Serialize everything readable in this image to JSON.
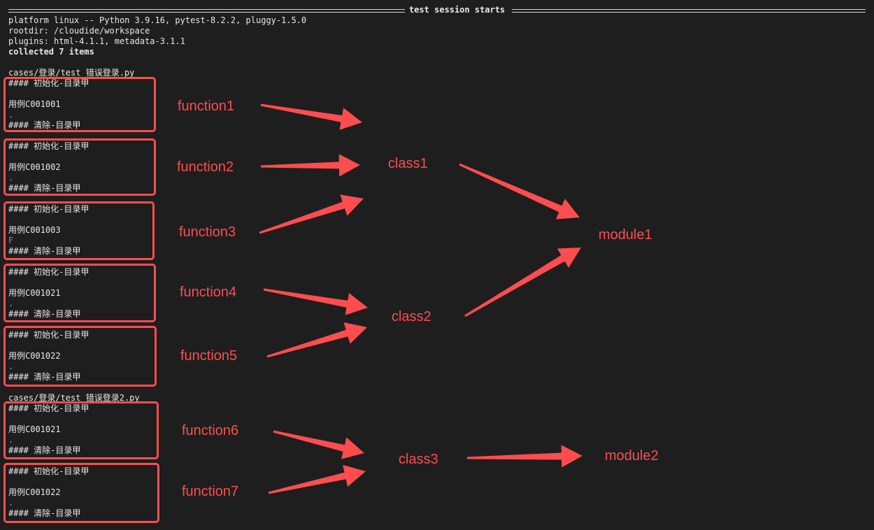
{
  "terminal": {
    "session_header": "test session starts",
    "platform_line": "platform linux -- Python 3.9.16, pytest-8.2.2, pluggy-1.5.0",
    "rootdir_line": "rootdir: /cloudide/workspace",
    "plugins_line": "plugins: html-4.1.1, metadata-3.1.1",
    "collected_line": "collected 7 items",
    "file1_path": "cases/登录/test_错误登录.py",
    "file2_path": "cases/登录/test_错误登录2.py",
    "tests": [
      {
        "setup": "#### 初始化-目录甲",
        "case": "用例C001001",
        "result": ".",
        "teardown": "#### 清除-目录甲"
      },
      {
        "setup": "#### 初始化-目录甲",
        "case": "用例C001002",
        "result": ".",
        "teardown": "#### 清除-目录甲"
      },
      {
        "setup": "#### 初始化-目录甲",
        "case": "用例C001003",
        "result": "F",
        "teardown": "#### 清除-目录甲"
      },
      {
        "setup": "#### 初始化-目录甲",
        "case": "用例C001021",
        "result": ".",
        "teardown": "#### 清除-目录甲"
      },
      {
        "setup": "#### 初始化-目录甲",
        "case": "用例C001022",
        "result": ".",
        "teardown": "#### 清除-目录甲"
      },
      {
        "setup": "#### 初始化-目录甲",
        "case": "用例C001021",
        "result": ".",
        "teardown": "#### 清除-目录甲"
      },
      {
        "setup": "#### 初始化-目录甲",
        "case": "用例C001022",
        "result": ".",
        "teardown": "#### 清除-目录甲"
      }
    ]
  },
  "annotations": {
    "functions": [
      "function1",
      "function2",
      "function3",
      "function4",
      "function5",
      "function6",
      "function7"
    ],
    "classes": [
      "class1",
      "class2",
      "class3"
    ],
    "modules": [
      "module1",
      "module2"
    ]
  },
  "colors": {
    "background": "#1e1e1e",
    "annotation_red": "#ff4d4f",
    "pass_dot": "#3ec9b0",
    "fail_mark": "#ff5a5a",
    "text": "#e8e8e8"
  }
}
